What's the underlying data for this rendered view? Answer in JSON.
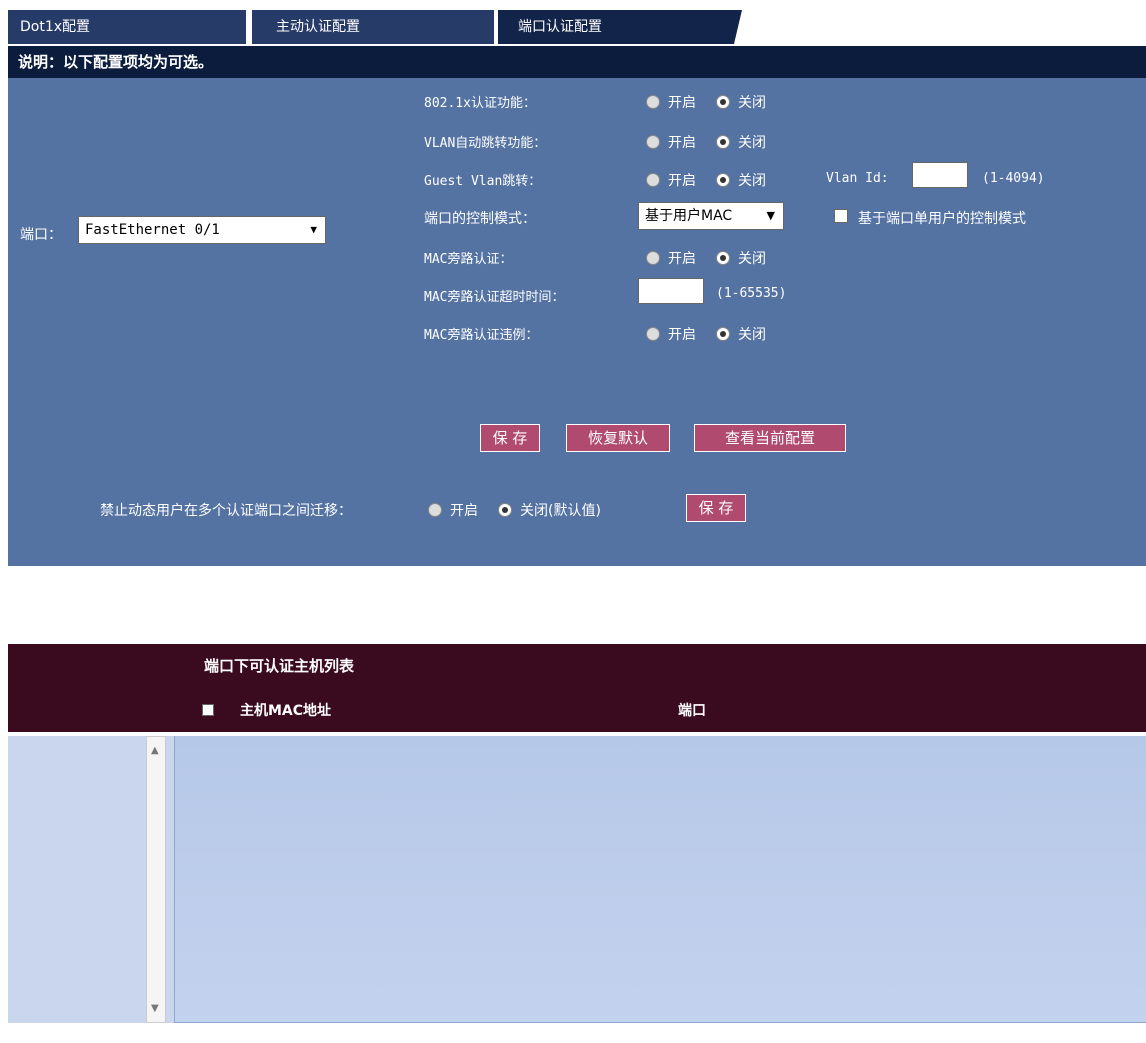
{
  "tabs": [
    {
      "label": "Dot1x配置"
    },
    {
      "label": "主动认证配置"
    },
    {
      "label": "端口认证配置"
    }
  ],
  "note": "说明：以下配置项均为可选。",
  "port": {
    "label": "端口：",
    "value": "FastEthernet 0/1"
  },
  "options": {
    "on": "开启",
    "off": "关闭",
    "dot1x": "802.1x认证功能：",
    "vlan_jump": "VLAN自动跳转功能：",
    "guest_vlan": "Guest Vlan跳转：",
    "vlan_id_label": "Vlan Id:",
    "vlan_id_range": "(1-4094)",
    "control_mode": "端口的控制模式：",
    "control_mode_value": "基于用户MAC",
    "single_user_mode": "基于端口单用户的控制模式",
    "mab": "MAC旁路认证：",
    "mab_timeout": "MAC旁路认证超时时间：",
    "mab_timeout_range": "(1-65535)",
    "mab_violation": "MAC旁路认证违例："
  },
  "buttons": {
    "save": "保 存",
    "restore": "恢复默认",
    "view": "查看当前配置",
    "save2": "保 存"
  },
  "migration": {
    "label": "禁止动态用户在多个认证端口之间迁移：",
    "on": "开启",
    "off": "关闭(默认值)"
  },
  "list": {
    "title": "端口下可认证主机列表",
    "col_mac": "主机MAC地址",
    "col_port": "端口"
  }
}
